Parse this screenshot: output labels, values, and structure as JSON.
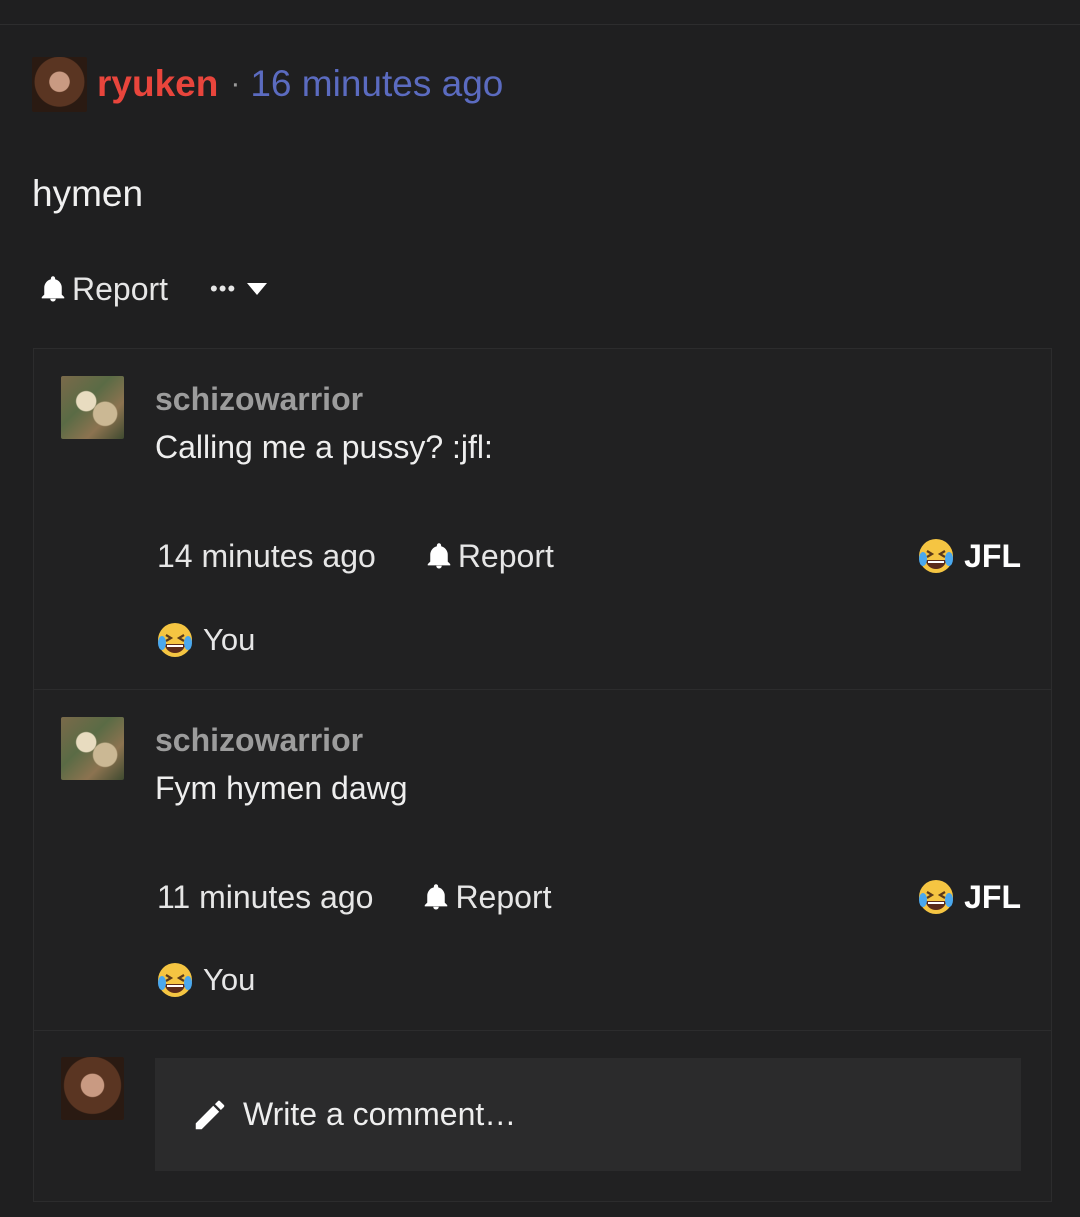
{
  "post": {
    "username": "ryuken",
    "separator": "·",
    "time": "16 minutes ago",
    "body": "hymen",
    "report_label": "Report",
    "more_label": "•••"
  },
  "comments": [
    {
      "username": "schizowarrior",
      "text": "Calling me a pussy? :jfl:",
      "time": "14 minutes ago",
      "report_label": "Report",
      "reaction_label": "JFL",
      "reacted_by": "You"
    },
    {
      "username": "schizowarrior",
      "text": "Fym hymen dawg",
      "time": "11 minutes ago",
      "report_label": "Report",
      "reaction_label": "JFL",
      "reacted_by": "You"
    }
  ],
  "composer": {
    "placeholder": "Write a comment…"
  },
  "colors": {
    "background": "#1f1f20",
    "op_username": "#e8453c",
    "timestamp_link": "#5b6bc0",
    "comment_username": "#9c9c9c"
  },
  "icons": [
    "bell-icon",
    "more-icon",
    "chevron-down-icon",
    "crying-laughing-emoji-icon",
    "pencil-icon"
  ]
}
